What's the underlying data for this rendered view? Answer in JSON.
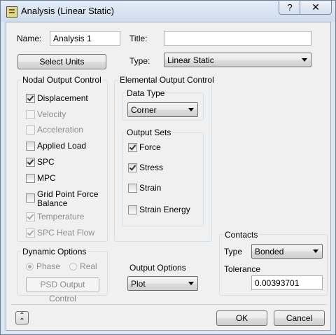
{
  "window": {
    "title": "Analysis (Linear Static)",
    "help_label": "?",
    "close_label": "✕"
  },
  "name": {
    "label": "Name:",
    "value": "Analysis 1"
  },
  "title_field": {
    "label": "Title:",
    "value": ""
  },
  "select_units_label": "Select Units",
  "type": {
    "label": "Type:",
    "value": "Linear Static"
  },
  "nodal": {
    "title": "Nodal Output Control",
    "items": [
      {
        "label": "Displacement",
        "checked": true,
        "enabled": true
      },
      {
        "label": "Velocity",
        "checked": false,
        "enabled": false
      },
      {
        "label": "Acceleration",
        "checked": false,
        "enabled": false
      },
      {
        "label": "Applied Load",
        "checked": false,
        "enabled": true
      },
      {
        "label": "SPC",
        "checked": true,
        "enabled": true
      },
      {
        "label": "MPC",
        "checked": false,
        "enabled": true
      },
      {
        "label": "Grid Point Force",
        "label2": "Balance",
        "checked": false,
        "enabled": true
      },
      {
        "label": "Temperature",
        "checked": true,
        "enabled": false
      },
      {
        "label": "SPC Heat Flow",
        "checked": true,
        "enabled": false
      }
    ]
  },
  "elemental": {
    "title": "Elemental Output Control",
    "data_type": {
      "title": "Data Type",
      "value": "Corner"
    },
    "output_sets": {
      "title": "Output Sets",
      "items": [
        {
          "label": "Force",
          "checked": true
        },
        {
          "label": "Stress",
          "checked": true
        },
        {
          "label": "Strain",
          "checked": false
        },
        {
          "label": "Strain Energy",
          "checked": false
        }
      ]
    }
  },
  "dynamic": {
    "title": "Dynamic Options",
    "phase_label": "Phase",
    "real_label": "Real",
    "selected": "Phase",
    "psd_label": "PSD Output Control"
  },
  "output_options": {
    "label": "Output Options",
    "value": "Plot"
  },
  "contacts": {
    "title": "Contacts",
    "type_label": "Type",
    "type_value": "Bonded",
    "tolerance_label": "Tolerance",
    "tolerance_value": "0.00393701"
  },
  "footer": {
    "collapse_icon": "chevrons-up-icon",
    "ok_label": "OK",
    "cancel_label": "Cancel"
  }
}
